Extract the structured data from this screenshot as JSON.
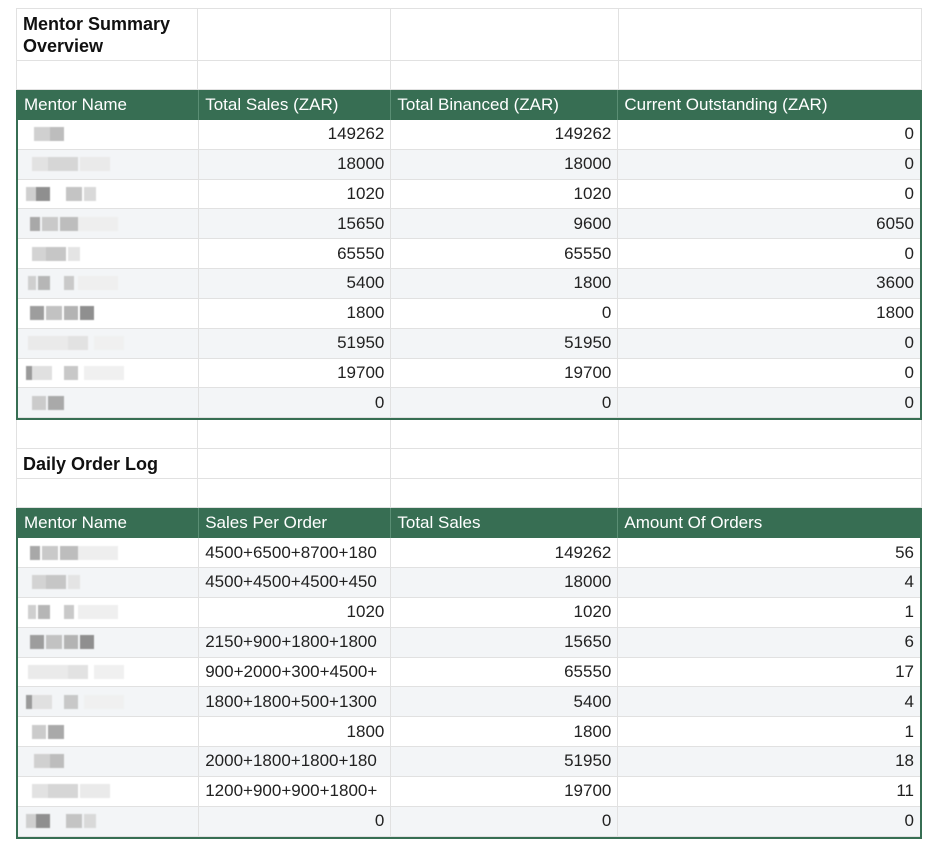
{
  "summary": {
    "title": "Mentor Summary Overview",
    "headers": [
      "Mentor Name",
      "Total Sales (ZAR)",
      "Total Binanced (ZAR)",
      "Current Outstanding (ZAR)"
    ],
    "rows": [
      [
        "149262",
        "149262",
        "0"
      ],
      [
        "18000",
        "18000",
        "0"
      ],
      [
        "1020",
        "1020",
        "0"
      ],
      [
        "15650",
        "9600",
        "6050"
      ],
      [
        "65550",
        "65550",
        "0"
      ],
      [
        "5400",
        "1800",
        "3600"
      ],
      [
        "1800",
        "0",
        "1800"
      ],
      [
        "51950",
        "51950",
        "0"
      ],
      [
        "19700",
        "19700",
        "0"
      ],
      [
        "0",
        "0",
        "0"
      ]
    ]
  },
  "log": {
    "title": "Daily Order Log",
    "headers": [
      "Mentor Name",
      "Sales Per Order",
      "Total Sales",
      "Amount Of Orders"
    ],
    "rows": [
      [
        "4500+6500+8700+180",
        "149262",
        "56"
      ],
      [
        "4500+4500+4500+450",
        "18000",
        "4"
      ],
      [
        "1020",
        "1020",
        "1"
      ],
      [
        "2150+900+1800+1800",
        "15650",
        "6"
      ],
      [
        "900+2000+300+4500+",
        "65550",
        "17"
      ],
      [
        "1800+1800+500+1300",
        "5400",
        "4"
      ],
      [
        "1800",
        "1800",
        "1"
      ],
      [
        "2000+1800+1800+180",
        "51950",
        "18"
      ],
      [
        "1200+900+900+1800+",
        "19700",
        "11"
      ],
      [
        "0",
        "0",
        "0"
      ]
    ]
  },
  "colors": {
    "header_bg": "#376e53",
    "header_text": "#ffffff",
    "band": "#f3f5f7"
  }
}
